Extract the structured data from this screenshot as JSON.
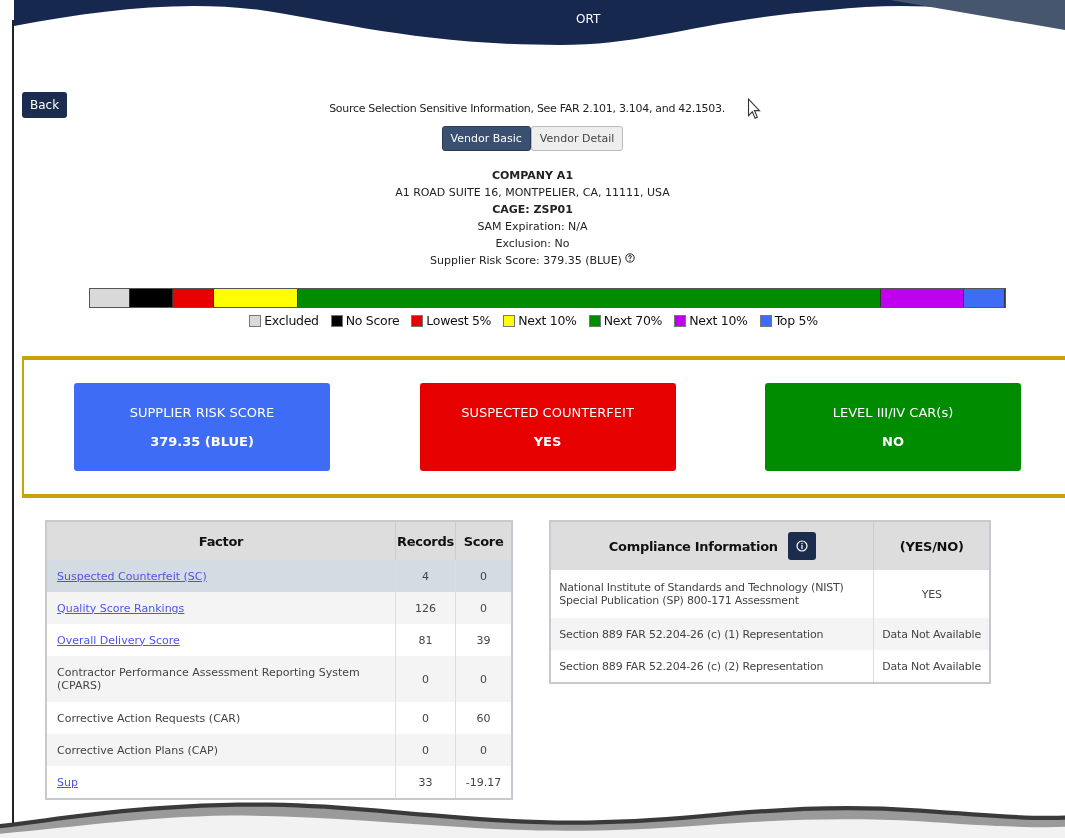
{
  "header": {
    "title": "ORT"
  },
  "back_button": "Back",
  "notice": "Source Selection Sensitive Information, See FAR 2.101, 3.104, and 42.1503.",
  "tabs": [
    {
      "label": "Vendor Basic",
      "selected": true
    },
    {
      "label": "Vendor Detail",
      "selected": false
    }
  ],
  "vendor": {
    "name": "COMPANY A1",
    "address": "A1 ROAD SUITE 16, MONTPELIER, CA, 11111, USA",
    "cage": "CAGE: ZSP01",
    "sam_expiration": "SAM Expiration: N/A",
    "exclusion": "Exclusion: No",
    "risk_score": "Supplier Risk Score: 379.35 (BLUE)"
  },
  "score_bar": [
    {
      "label": "Excluded",
      "color": "#d9d9d9"
    },
    {
      "label": "No Score",
      "color": "#000000"
    },
    {
      "label": "Lowest 5%",
      "color": "#e60000"
    },
    {
      "label": "Next 10%",
      "color": "#ffff00"
    },
    {
      "label": "Next 70%",
      "color": "#008c00"
    },
    {
      "label": "Next 10%",
      "color": "#c000f0"
    },
    {
      "label": "Top 5%",
      "color": "#3f6cf5"
    }
  ],
  "summary_cards": [
    {
      "title": "SUPPLIER RISK SCORE",
      "value": "379.35 (BLUE)",
      "color": "#3f6cf5"
    },
    {
      "title": "SUSPECTED COUNTERFEIT",
      "value": "YES",
      "color": "#e60000"
    },
    {
      "title": "LEVEL III/IV CAR(s)",
      "value": "NO",
      "color": "#008c00"
    }
  ],
  "factor_table": {
    "columns": [
      "Factor",
      "Records",
      "Score"
    ],
    "rows": [
      {
        "factor": "Suspected Counterfeit (SC)",
        "kind": "link",
        "records": "4",
        "score": "0",
        "selected": true
      },
      {
        "factor": "Quality Score Rankings",
        "kind": "link",
        "records": "126",
        "score": "0",
        "selected": false
      },
      {
        "factor": "Overall Delivery Score",
        "kind": "link",
        "records": "81",
        "score": "39",
        "selected": false
      },
      {
        "factor": "Contractor Performance Assessment Reporting System (CPARS)",
        "kind": "text",
        "records": "0",
        "score": "0",
        "selected": false
      },
      {
        "factor": "Corrective Action Requests (CAR)",
        "kind": "text",
        "records": "0",
        "score": "60",
        "selected": false
      },
      {
        "factor": "Corrective Action Plans (CAP)",
        "kind": "text",
        "records": "0",
        "score": "0",
        "selected": false
      },
      {
        "factor": "Sup",
        "kind": "link",
        "records": "33",
        "score": "-19.17",
        "selected": false
      }
    ]
  },
  "compliance_table": {
    "columns": [
      "Compliance Information",
      "(YES/NO)"
    ],
    "rows": [
      {
        "item": "National Institute of Standards and Technology (NIST) Special Publication (SP) 800-171 Assessment",
        "value": "YES"
      },
      {
        "item": "Section 889 FAR 52.204-26 (c) (1) Representation",
        "value": "Data Not Available"
      },
      {
        "item": "Section 889 FAR 52.204-26 (c) (2) Representation",
        "value": "Data Not Available"
      }
    ]
  }
}
